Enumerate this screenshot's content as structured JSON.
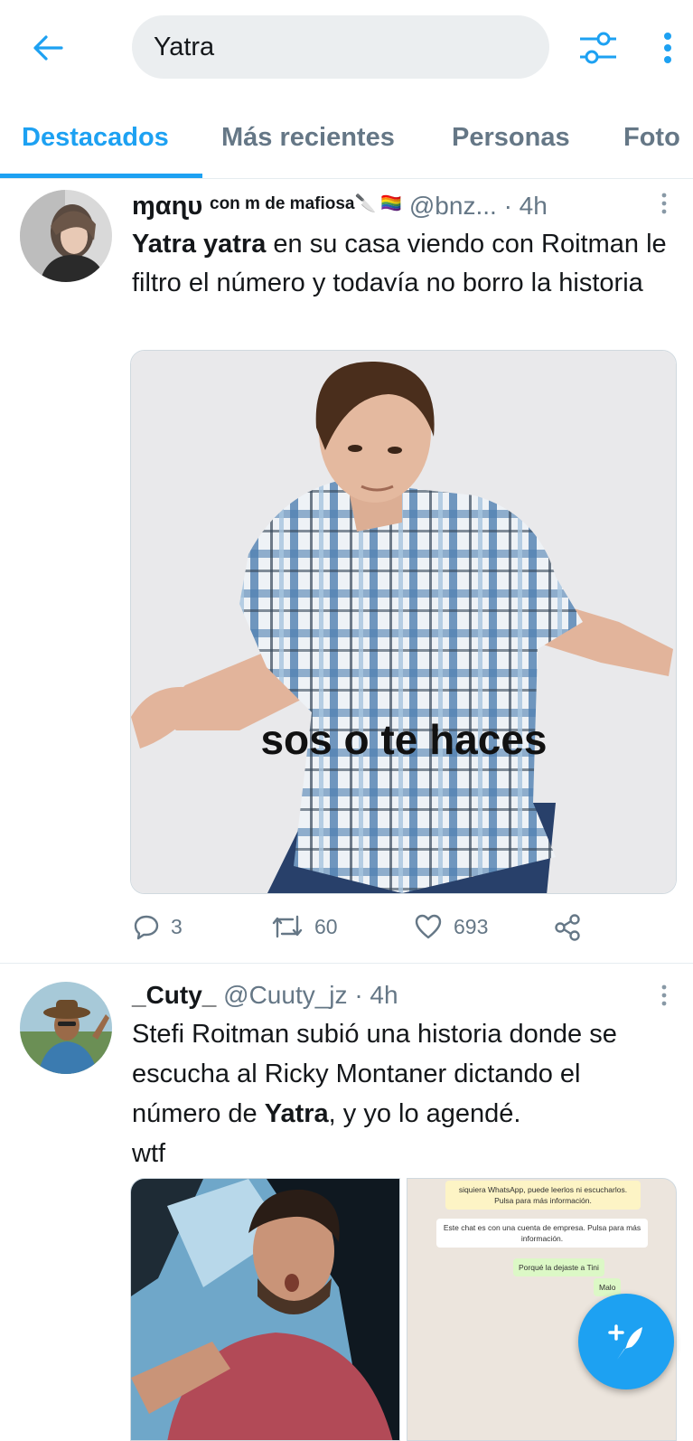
{
  "search": {
    "query": "Yatra"
  },
  "tabs": [
    {
      "label": "Destacados"
    },
    {
      "label": "Más recientes"
    },
    {
      "label": "Personas"
    },
    {
      "label": "Foto"
    }
  ],
  "tweets": [
    {
      "display_name": "ɱαɳυ",
      "name_suffix": "con m de mafiosa🔪 🏳️‍🌈",
      "handle": "@bnz...",
      "time": "· 4h",
      "text_bold": "Yatra yatra",
      "text_rest": " en su casa viendo con Roitman le filtro el número y todavía no borro la historia",
      "image_caption": "sos o te haces",
      "replies": "3",
      "retweets": "60",
      "likes": "693"
    },
    {
      "display_name": "_Cuty_",
      "handle": "@Cuuty_jz",
      "time": "· 4h",
      "text_before": "Stefi Roitman subió una historia donde se escucha al Ricky Montaner dictando el número de ",
      "text_bold": "Yatra",
      "text_after": ", y yo lo agendé.",
      "text_last": "wtf",
      "chat": {
        "msg1": "siquiera WhatsApp, puede leerlos ni escucharlos. Pulsa para más información.",
        "msg2": "Este chat es con una cuenta de empresa. Pulsa para más información.",
        "msg3": "Porqué la dejaste a Tini",
        "msg4": "Malo"
      }
    }
  ],
  "colors": {
    "accent": "#1da1f2",
    "secondary_text": "#657786",
    "divider": "#e6ecf0"
  }
}
